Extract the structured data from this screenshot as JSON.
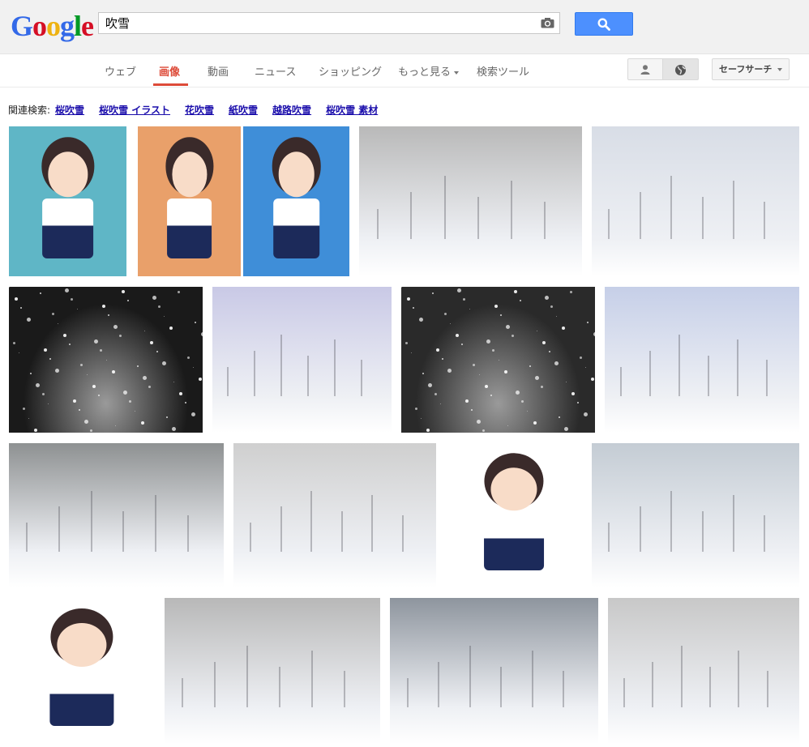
{
  "logo": {
    "letters": [
      "G",
      "o",
      "o",
      "g",
      "l",
      "e"
    ],
    "colors": [
      "#3369e8",
      "#d50f25",
      "#eeb211",
      "#3369e8",
      "#009925",
      "#d50f25"
    ]
  },
  "search": {
    "value": "吹雪",
    "placeholder": ""
  },
  "nav": {
    "items": [
      "ウェブ",
      "画像",
      "動画",
      "ニュース",
      "ショッピング",
      "もっと見る",
      "検索ツール"
    ],
    "active_index": 1
  },
  "safe_search_label": "セーフサーチ",
  "related": {
    "prefix": "関連検索:",
    "links": [
      "桜吹雪",
      "桜吹雪 イラスト",
      "花吹雪",
      "紙吹雪",
      "越路吹雪",
      "桜吹雪 素材"
    ]
  },
  "images": [
    {
      "name": "anime-fubuki-cover",
      "kind": "anime",
      "bg": "#5fb6c6"
    },
    {
      "name": "anime-fubuki-poster",
      "kind": "anime",
      "bg": "#e9a06a"
    },
    {
      "name": "anime-fubuki-sky",
      "kind": "anime",
      "bg": "#3f8ed8"
    },
    {
      "name": "snowy-forest",
      "kind": "snow",
      "bg": "#b9b9b9"
    },
    {
      "name": "snow-field-trees",
      "kind": "snow",
      "bg": "#d8dde6"
    },
    {
      "name": "night-snowfall",
      "kind": "night",
      "bg": "#1a1a1a"
    },
    {
      "name": "people-blizzard",
      "kind": "snow",
      "bg": "#c9c9e6"
    },
    {
      "name": "dark-snow-road",
      "kind": "night",
      "bg": "#2a2a2a"
    },
    {
      "name": "dog-in-snow",
      "kind": "snow",
      "bg": "#c6cfe8"
    },
    {
      "name": "soldiers-blizzard",
      "kind": "snow",
      "bg": "#8e9192"
    },
    {
      "name": "crashed-cars",
      "kind": "snow",
      "bg": "#cfcfcf"
    },
    {
      "name": "anime-fubuki-standing",
      "kind": "anime",
      "bg": "#ffffff"
    },
    {
      "name": "cars-snow-road",
      "kind": "snow",
      "bg": "#c4ccd4"
    },
    {
      "name": "anime-fubuki-closeup",
      "kind": "anime",
      "bg": "#ffffff"
    },
    {
      "name": "foggy-trees",
      "kind": "snow",
      "bg": "#b8b8b8"
    },
    {
      "name": "snowy-pine-forest",
      "kind": "snow",
      "bg": "#8e959e"
    },
    {
      "name": "snowflakes-trees",
      "kind": "snow",
      "bg": "#c8c8c8"
    }
  ]
}
